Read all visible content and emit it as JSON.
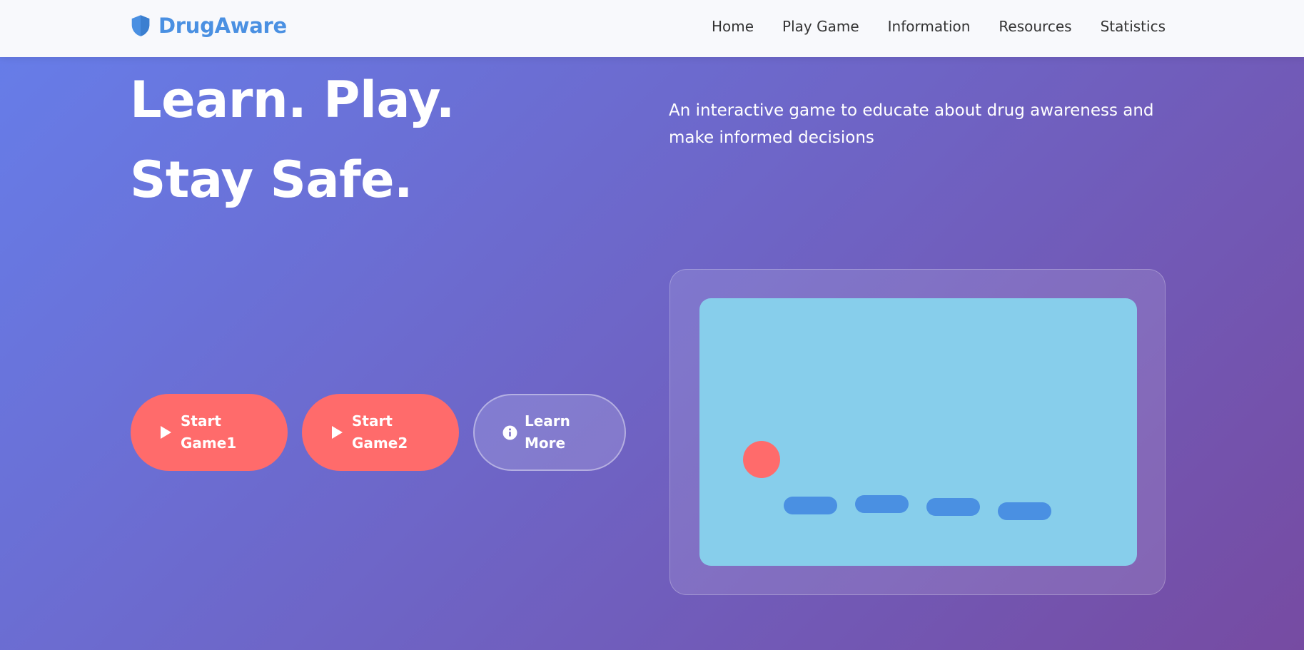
{
  "brand": {
    "name": "DrugAware",
    "icon": "shield-icon",
    "color": "#4a90e2"
  },
  "nav": {
    "items": [
      {
        "label": "Home"
      },
      {
        "label": "Play Game"
      },
      {
        "label": "Information"
      },
      {
        "label": "Resources"
      },
      {
        "label": "Statistics"
      }
    ]
  },
  "hero": {
    "title": "Learn. Play. Stay Safe.",
    "subtitle": "An interactive game to educate about drug awareness and make informed decisions"
  },
  "buttons": {
    "start_game1": {
      "label": "Start Game1",
      "icon": "play-icon"
    },
    "start_game2": {
      "label": "Start Game2",
      "icon": "play-icon"
    },
    "learn_more": {
      "label": "Learn More",
      "icon": "info-icon"
    }
  },
  "colors": {
    "gradient_start": "#667eea",
    "gradient_end": "#764ba2",
    "accent": "#ff6b6b",
    "game_sky": "#87ceeb",
    "platform": "#4a90e2"
  }
}
